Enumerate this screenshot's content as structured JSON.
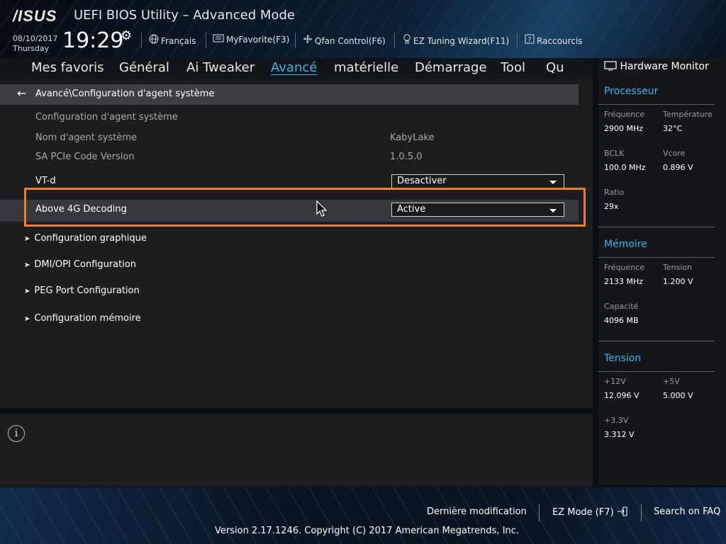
{
  "header": {
    "logo": "/ISUS",
    "title": "UEFI BIOS Utility – Advanced Mode",
    "date": "08/10/2017",
    "day": "Thursday",
    "time": "19:29",
    "items": [
      {
        "label": "Français",
        "icon": "globe-icon"
      },
      {
        "label": "MyFavorite(F3)",
        "icon": "favorite-icon"
      },
      {
        "label": "Qfan Control(F6)",
        "icon": "fan-icon"
      },
      {
        "label": "EZ Tuning Wizard(F11)",
        "icon": "bulb-icon"
      },
      {
        "label": "Raccourcis",
        "icon": "help-icon"
      }
    ]
  },
  "tabs": [
    "Mes favoris",
    "Général",
    "Ai Tweaker",
    "Avancé",
    "matérielle",
    "Démarrage",
    "Tool",
    "Qu"
  ],
  "active_tab": "Avancé",
  "breadcrumb": "Avancé\\Configuration d'agent système",
  "rows": {
    "section_title": "Configuration d'agent système",
    "agent_name_label": "Nom d'agent système",
    "agent_name_value": "KabyLake",
    "pcie_label": "SA PCIe Code Version",
    "pcie_value": "1.0.5.0",
    "vtd_label": "VT-d",
    "vtd_value": "Desactiver",
    "above4g_label": "Above 4G Decoding",
    "above4g_value": "Active"
  },
  "submenus": [
    "Configuration graphique",
    "DMI/OPI Configuration",
    "PEG Port Configuration",
    "Configuration mémoire"
  ],
  "hardware_monitor": {
    "title": "Hardware Monitor",
    "processeur": {
      "title": "Processeur",
      "freq_label": "Fréquence",
      "freq_value": "2900 MHz",
      "temp_label": "Température",
      "temp_value": "32°C",
      "bclk_label": "BCLK",
      "bclk_value": "100.0 MHz",
      "vcore_label": "Vcore",
      "vcore_value": "0.896 V",
      "ratio_label": "Ratio",
      "ratio_value": "29x"
    },
    "memoire": {
      "title": "Mémoire",
      "freq_label": "Fréquence",
      "freq_value": "2133 MHz",
      "tension_label": "Tension",
      "tension_value": "1.200 V",
      "cap_label": "Capacité",
      "cap_value": "4096 MB"
    },
    "tension": {
      "title": "Tension",
      "v12_label": "+12V",
      "v12_value": "12.096 V",
      "v5_label": "+5V",
      "v5_value": "5.000 V",
      "v33_label": "+3.3V",
      "v33_value": "3.312 V"
    }
  },
  "footer": {
    "last_mod": "Dernière modification",
    "ez_mode": "EZ Mode (F7)",
    "faq": "Search on FAQ",
    "copyright": "Version 2.17.1246. Copyright (C) 2017 American Megatrends, Inc."
  },
  "colors": {
    "accent": "#39b7e8",
    "highlight": "#ee7b2e"
  }
}
